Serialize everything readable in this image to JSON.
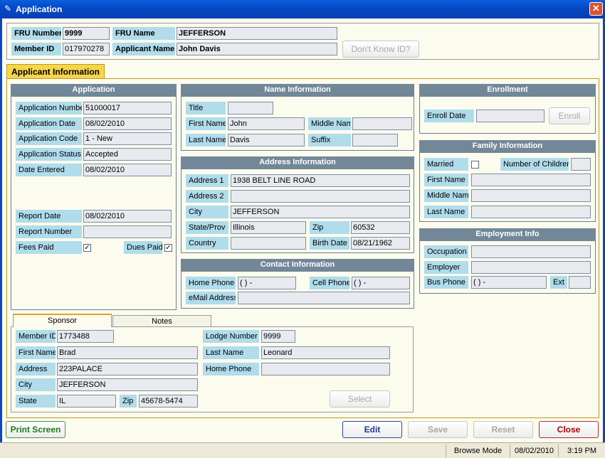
{
  "window": {
    "title": "Application",
    "icon": "app-icon",
    "close_glyph": "✕"
  },
  "header": {
    "fru_number_label": "FRU Number",
    "fru_number": "9999",
    "fru_name_label": "FRU Name",
    "fru_name": "JEFFERSON",
    "member_id_label": "Member ID",
    "member_id": "017970278",
    "applicant_name_label": "Applicant Name",
    "applicant_name": "John Davis",
    "dont_know_label": "Don't Know ID?"
  },
  "tab": {
    "label": "Applicant Information"
  },
  "application": {
    "title": "Application",
    "number_label": "Application Number",
    "number": "51000017",
    "date_label": "Application Date",
    "date": "08/02/2010",
    "code_label": "Application Code",
    "code": "1 - New",
    "status_label": "Application Status",
    "status": "Accepted",
    "entered_label": "Date Entered",
    "entered": "08/02/2010",
    "report_date_label": "Report Date",
    "report_date": "08/02/2010",
    "report_number_label": "Report Number",
    "report_number": "",
    "fees_paid_label": "Fees Paid",
    "fees_paid": "✓",
    "dues_paid_label": "Dues Paid",
    "dues_paid": "✓"
  },
  "name_info": {
    "title": "Name Information",
    "title_label": "Title",
    "title_value": "",
    "first_label": "First Name",
    "first": "John",
    "middle_label": "Middle Name",
    "middle": "",
    "last_label": "Last Name",
    "last": "Davis",
    "suffix_label": "Suffix",
    "suffix": ""
  },
  "address_info": {
    "title": "Address Information",
    "addr1_label": "Address 1",
    "addr1": "1938 BELT LINE ROAD",
    "addr2_label": "Address 2",
    "addr2": "",
    "city_label": "City",
    "city": "JEFFERSON",
    "state_label": "State/Prov",
    "state": "Illinois",
    "zip_label": "Zip",
    "zip": "60532",
    "country_label": "Country",
    "country": "",
    "birth_label": "Birth Date",
    "birth": "08/21/1962"
  },
  "contact_info": {
    "title": "Contact Information",
    "home_label": "Home Phone",
    "home": "(     )      -",
    "cell_label": "Cell Phone",
    "cell": "(     )      -",
    "email_label": "eMail Address",
    "email": ""
  },
  "enrollment": {
    "title": "Enrollment",
    "date_label": "Enroll Date",
    "date": "",
    "enroll_label": "Enroll"
  },
  "family": {
    "title": "Family Information",
    "married_label": "Married",
    "married": "",
    "children_label": "Number of Children",
    "children": "",
    "first_label": "First Name",
    "first": "",
    "middle_label": "Middle Name",
    "middle": "",
    "last_label": "Last Name",
    "last": ""
  },
  "employment": {
    "title": "Employment Info",
    "occupation_label": "Occupation",
    "occupation": "",
    "employer_label": "Employer",
    "employer": "",
    "phone_label": "Bus Phone",
    "phone": "(     )      -",
    "ext_label": "Ext",
    "ext": ""
  },
  "sub_tabs": {
    "sponsor": "Sponsor",
    "notes": "Notes"
  },
  "sponsor": {
    "member_id_label": "Member ID",
    "member_id": "1773488",
    "lodge_label": "Lodge Number",
    "lodge": "9999",
    "first_label": "First Name",
    "first": "Brad",
    "last_label": "Last Name",
    "last": "Leonard",
    "address_label": "Address",
    "address": "223PALACE",
    "home_phone_label": "Home Phone",
    "home_phone": "",
    "city_label": "City",
    "city": "JEFFERSON",
    "state_label": "State",
    "state": "IL",
    "zip_label": "Zip",
    "zip": "45678-5474",
    "select_label": "Select"
  },
  "buttons": {
    "print": "Print Screen",
    "edit": "Edit",
    "save": "Save",
    "reset": "Reset",
    "close": "Close"
  },
  "status": {
    "mode": "Browse Mode",
    "date": "08/02/2010",
    "time": "3:19 PM"
  },
  "colors": {
    "title_bar": "#0349c6",
    "label_bg": "#b0dcec",
    "section_header": "#728798",
    "tab": "#f7d54a",
    "print_text": "#1a7a1a",
    "close_text": "#b00000",
    "edit_text": "#1a3a8a"
  }
}
